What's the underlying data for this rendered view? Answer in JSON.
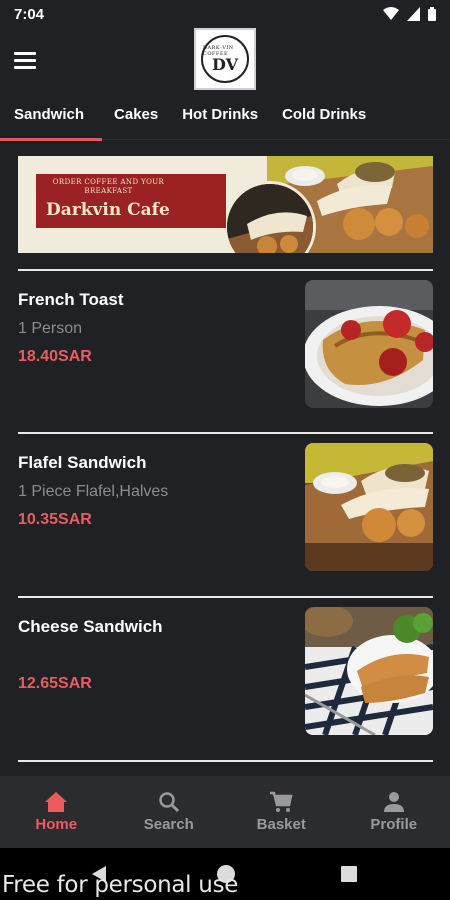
{
  "status": {
    "time": "7:04"
  },
  "header": {
    "logo_top": "DARK·VIN COFFEE",
    "logo_mono": "DV"
  },
  "tabs": [
    {
      "label": "Sandwich",
      "active": true
    },
    {
      "label": "Cakes",
      "active": false
    },
    {
      "label": "Hot Drinks",
      "active": false
    },
    {
      "label": "Cold Drinks",
      "active": false
    }
  ],
  "banner": {
    "small_text": "ORDER COFFEE AND YOUR BREAKFAST",
    "title": "Darkvin Cafe"
  },
  "items": [
    {
      "title": "French Toast",
      "desc": "1 Person",
      "price": "18.40SAR"
    },
    {
      "title": "Flafel Sandwich",
      "desc": "1 Piece Flafel,Halves",
      "price": "10.35SAR"
    },
    {
      "title": "Cheese Sandwich",
      "desc": "",
      "price": "12.65SAR"
    }
  ],
  "bottom_nav": [
    {
      "label": "Home",
      "icon": "home-icon",
      "active": true
    },
    {
      "label": "Search",
      "icon": "search-icon",
      "active": false
    },
    {
      "label": "Basket",
      "icon": "cart-icon",
      "active": false
    },
    {
      "label": "Profile",
      "icon": "person-icon",
      "active": false
    }
  ],
  "watermark": "Free for personal use",
  "colors": {
    "accent": "#ea5c60",
    "background": "#202124",
    "nav_bg": "#2b2c30",
    "banner_red": "#9a2222"
  }
}
